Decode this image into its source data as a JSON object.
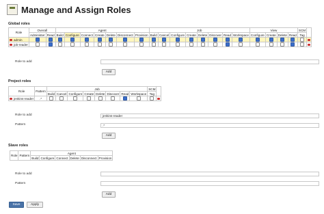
{
  "header": {
    "title": "Manage and Assign Roles",
    "logo_icon": "jenkins-logo-icon"
  },
  "global": {
    "section_title": "Global roles",
    "role_header": "Role",
    "groups": [
      "Overall",
      "Agent",
      "Job",
      "View",
      "SCM"
    ],
    "columns": [
      "Administer",
      "Read",
      "Build",
      "Configure",
      "Connect",
      "Create",
      "Delete",
      "Disconnect",
      "Provision",
      "Build",
      "Cancel",
      "Configure",
      "Create",
      "Delete",
      "Discover",
      "Read",
      "Workspace",
      "Configure",
      "Create",
      "Delete",
      "Read",
      "Tag"
    ],
    "rows": [
      {
        "name": "admin",
        "checked": [
          true,
          true,
          true,
          true,
          true,
          true,
          true,
          true,
          true,
          true,
          true,
          true,
          true,
          true,
          true,
          true,
          true,
          true,
          true,
          true,
          true,
          false
        ]
      },
      {
        "name": "job-reader",
        "checked": [
          false,
          true,
          false,
          false,
          false,
          false,
          false,
          false,
          false,
          false,
          false,
          false,
          false,
          false,
          false,
          true,
          false,
          false,
          false,
          false,
          true,
          false
        ]
      }
    ],
    "role_to_add_label": "Role to add",
    "add_label": "Add"
  },
  "project": {
    "section_title": "Project roles",
    "role_header": "Role",
    "pattern_header": "Pattern",
    "groups": [
      "Job",
      "SCM"
    ],
    "columns": [
      "Build",
      "Cancel",
      "Configure",
      "Create",
      "Delete",
      "Discover",
      "Read",
      "Workspace",
      "Tag"
    ],
    "rows": [
      {
        "name": "jenkins-reader",
        "pattern": ".*",
        "checked": [
          false,
          false,
          false,
          false,
          false,
          false,
          true,
          false,
          false
        ]
      }
    ],
    "role_to_add_label": "Role to add",
    "role_to_add_value": "jenkins-reader",
    "pattern_label": "Pattern",
    "pattern_value": ".*",
    "add_label": "Add"
  },
  "slave": {
    "section_title": "Slave roles",
    "role_header": "Role",
    "pattern_header": "Pattern",
    "groups": [
      "Agent"
    ],
    "columns": [
      "Build",
      "Configure",
      "Connect",
      "Delete",
      "Disconnect",
      "Provision"
    ],
    "role_to_add_label": "Role to add",
    "pattern_label": "Pattern",
    "add_label": "Add"
  },
  "footer": {
    "save_label": "Save",
    "apply_label": "Apply"
  },
  "colors": {
    "checkbox_on": "#3b6ec9",
    "highlight": "#fff6bd",
    "primary_button": "#4a73a8",
    "delete": "#cc3333"
  }
}
